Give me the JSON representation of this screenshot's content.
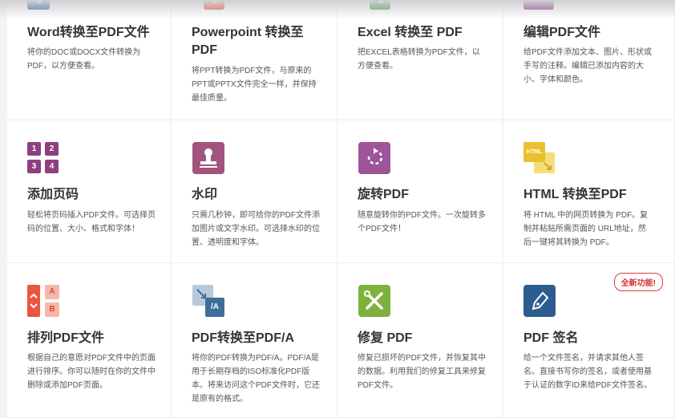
{
  "tools": [
    {
      "title": "Word转换至PDF文件",
      "desc": "将你的DOC或DOCX文件转换为PDF，以方便查看。"
    },
    {
      "title": "Powerpoint 转换至 PDF",
      "desc": "将PPT转换为PDF文件，与原来的PPT或PPTX文件完全一样，并保持最佳质量。"
    },
    {
      "title": "Excel 转换至 PDF",
      "desc": "把EXCEL表格转换为PDF文件，以方便查看。"
    },
    {
      "title": "编辑PDF文件",
      "desc": "给PDF文件添加文本、图片、形状或手写的注释。编辑已添加内容的大小、字体和颜色。"
    },
    {
      "title": "添加页码",
      "desc": "轻松将页码插入PDF文件。可选择页码的位置、大小、格式和字体！",
      "icon_text": [
        "1",
        "2",
        "3",
        "4"
      ]
    },
    {
      "title": "水印",
      "desc": "只需几秒钟，即可给你的PDF文件添加图片或文字水印。可选择水印的位置、透明度和字体。"
    },
    {
      "title": "旋转PDF",
      "desc": "随意旋转你的PDF文件。一次旋转多个PDF文件！"
    },
    {
      "title": "HTML 转换至PDF",
      "desc": "将 HTML 中的网页转换为 PDF。复制并粘贴所需页面的 URL地址，然后一键将其转换为 PDF。",
      "icon_text": "HTML"
    },
    {
      "title": "排列PDF文件",
      "desc": "根据自己的意愿对PDF文件中的页面进行排序。你可以随时在你的文件中删除或添加PDF页面。",
      "icon_text": [
        "A",
        "B"
      ]
    },
    {
      "title": "PDF转换至PDF/A",
      "desc": "将你的PDF转换为PDF/A。PDF/A是用于长期存档的ISO标准化PDF版本。将来访问这个PDF文件时，它还是原有的格式。",
      "icon_text": "/A"
    },
    {
      "title": "修复 PDF",
      "desc": "修复已损坏的PDF文件，并恢复其中的数据。利用我们的修复工具来修复PDF文件。"
    },
    {
      "title": "PDF 签名",
      "desc": "给一个文件签名，并请求其他人签名。直接书写你的签名，或者使用基于认证的数字ID来给PDF文件签名。",
      "badge": "全新功能!"
    }
  ],
  "colors": {
    "red": "#e8543d",
    "green": "#4f9a4a",
    "purple": "#8d3f7f",
    "watermark": "#a3537f",
    "rotate": "#9e5498",
    "html_yellow": "#e9c12e",
    "arrange_red": "#ea5440",
    "pdfa_blue": "#3f6f98",
    "repair_green": "#7fb13e",
    "sign_blue": "#2d5c8e"
  }
}
